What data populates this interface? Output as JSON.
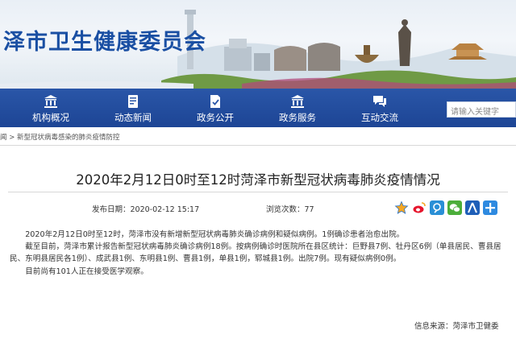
{
  "site": {
    "name": "泽市卫生健康委员会"
  },
  "nav": {
    "items": [
      {
        "label": "机构概况",
        "icon": "bank-icon"
      },
      {
        "label": "动态新闻",
        "icon": "document-icon"
      },
      {
        "label": "政务公开",
        "icon": "clipboard-check-icon"
      },
      {
        "label": "政务服务",
        "icon": "government-building-icon"
      },
      {
        "label": "互动交流",
        "icon": "chat-icon"
      }
    ],
    "search_placeholder": "请输入关键字"
  },
  "breadcrumb": {
    "prefix": "闻",
    "separator": " > ",
    "current": "新型冠状病毒感染的肺炎疫情防控"
  },
  "article": {
    "title": "2020年2月12日0时至12时菏泽市新型冠状病毒肺炎疫情情况",
    "publish_label": "发布日期：2020-02-12 15:17",
    "views_label": "浏览次数：77",
    "paragraphs": [
      "2020年2月12日0时至12时，菏泽市没有新增新型冠状病毒肺炎确诊病例和疑似病例。1例确诊患者治愈出院。",
      "截至目前，菏泽市累计报告新型冠状病毒肺炎确诊病例18例。按病例确诊时医院所在县区统计：巨野县7例、牡丹区6例（单县居民、曹县居民、东明县居民各1例）、成武县1例、东明县1例、曹县1例，单县1例，郓城县1例。出院7例。现有疑似病例0例。",
      "目前尚有101人正在接受医学观察。"
    ],
    "source": "信息来源：菏泽市卫健委"
  },
  "share": [
    {
      "icon": "qzone-star-icon",
      "color": "#f5a623"
    },
    {
      "icon": "weibo-icon",
      "color": "#e6162d"
    },
    {
      "icon": "tencent-weibo-icon",
      "color": "#2a8fd6"
    },
    {
      "icon": "wechat-icon",
      "color": "#4cae3a"
    },
    {
      "icon": "renren-icon",
      "color": "#1f5fb8"
    },
    {
      "icon": "more-share-icon",
      "color": "#2e8ae0"
    }
  ],
  "colors": {
    "nav_bg": "#1f4a9c",
    "brand_text": "#1a4fa3"
  }
}
